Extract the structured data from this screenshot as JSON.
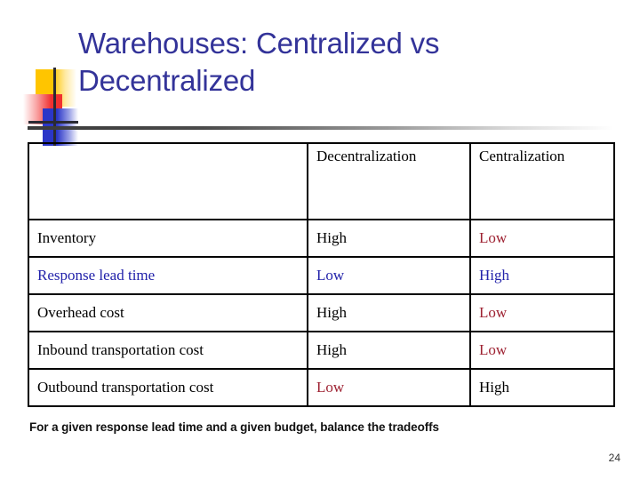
{
  "slide": {
    "title": "Warehouses: Centralized vs\nDecentralized",
    "title_color": "#333399",
    "footer_note": "For a given response lead time and a given budget, balance the tradeoffs",
    "slide_number": "24",
    "background_color": "#ffffff"
  },
  "logo": {
    "yellow": "#FFC500",
    "red": "#F03030",
    "blue": "#2B36C8",
    "cross": "#2A2A33"
  },
  "table": {
    "columns": [
      "",
      "Decentralization",
      "Centralization"
    ],
    "rows": [
      {
        "label": "Inventory",
        "decentralization": "High",
        "centralization": "Low",
        "label_ink": "ink-black",
        "decentralization_ink": "ink-black",
        "centralization_ink": "ink-red"
      },
      {
        "label": "Response lead time",
        "decentralization": "Low",
        "centralization": "High",
        "label_ink": "ink-blue",
        "decentralization_ink": "ink-blue",
        "centralization_ink": "ink-blue"
      },
      {
        "label": "Overhead cost",
        "decentralization": "High",
        "centralization": "Low",
        "label_ink": "ink-black",
        "decentralization_ink": "ink-black",
        "centralization_ink": "ink-red"
      },
      {
        "label": "Inbound transportation cost",
        "decentralization": "High",
        "centralization": "Low",
        "label_ink": "ink-black",
        "decentralization_ink": "ink-black",
        "centralization_ink": "ink-red"
      },
      {
        "label": "Outbound transportation cost",
        "decentralization": "Low",
        "centralization": "High",
        "label_ink": "ink-black",
        "decentralization_ink": "ink-red",
        "centralization_ink": "ink-black"
      }
    ]
  }
}
